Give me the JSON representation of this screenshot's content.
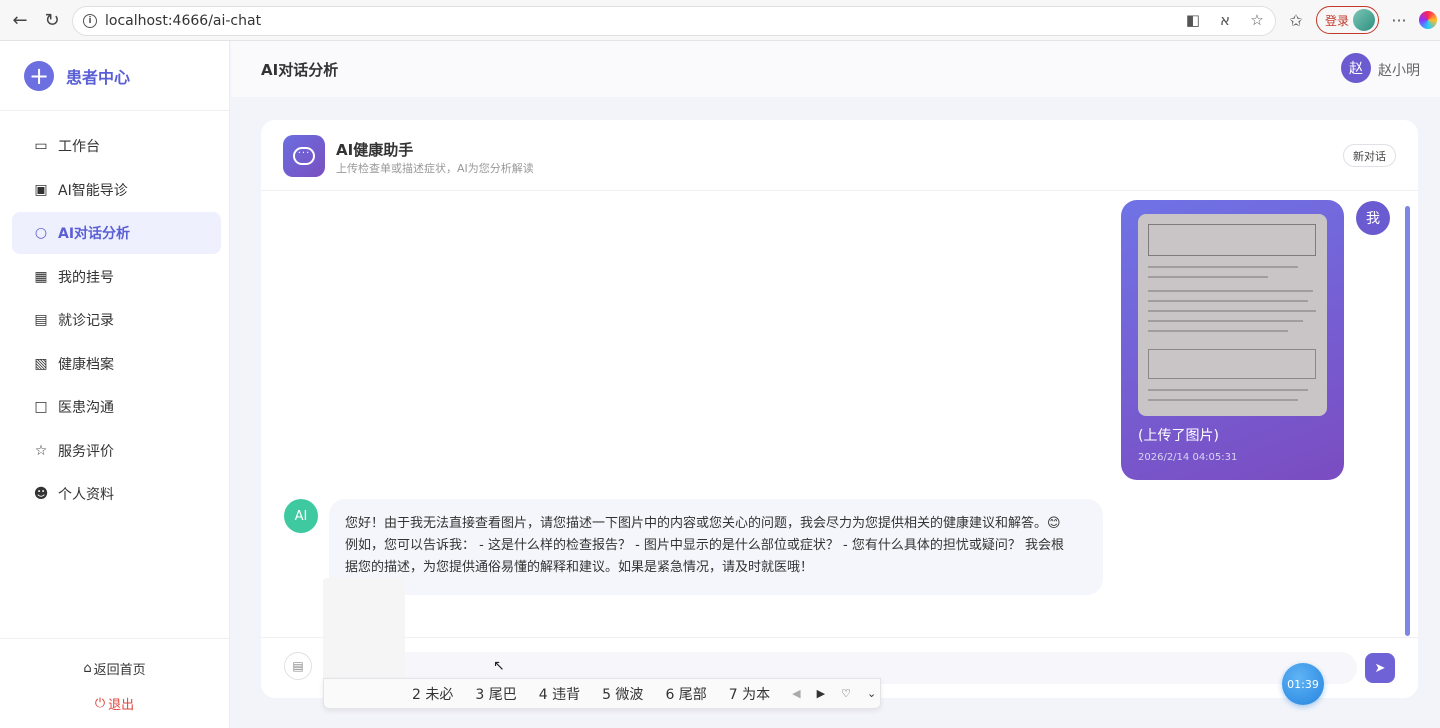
{
  "browser": {
    "url": "localhost:4666/ai-chat",
    "login_label": "登录"
  },
  "sidebar": {
    "brand": "患者中心",
    "items": [
      {
        "label": "工作台",
        "icon": "monitor-icon"
      },
      {
        "label": "AI智能导诊",
        "icon": "chip-icon"
      },
      {
        "label": "AI对话分析",
        "icon": "chat-dots-icon",
        "active": true
      },
      {
        "label": "我的挂号",
        "icon": "calendar-icon"
      },
      {
        "label": "就诊记录",
        "icon": "document-icon"
      },
      {
        "label": "健康档案",
        "icon": "chart-board-icon"
      },
      {
        "label": "医患沟通",
        "icon": "message-icon"
      },
      {
        "label": "服务评价",
        "icon": "star-icon"
      },
      {
        "label": "个人资料",
        "icon": "user-icon"
      }
    ],
    "back_home": "返回首页",
    "logout": "退出"
  },
  "header": {
    "title": "AI对话分析",
    "avatar_char": "赵",
    "user_name": "赵小明"
  },
  "chat": {
    "assistant_name": "AI健康助手",
    "assistant_subtitle": "上传检查单或描述症状，AI为您分析解读",
    "new_chat": "新对话",
    "user_message": {
      "avatar": "我",
      "caption": "(上传了图片)",
      "time": "2026/2/14 04:05:31"
    },
    "ai_message": {
      "avatar": "AI",
      "lines": [
        "您好！由于我无法直接查看图片，请您描述一下图片中的内容或您关心的问题，我会尽力为您提供相关的健康建议和解答。😊",
        "例如，您可以告诉我： - 这是什么样的检查报告？ - 图片中显示的是什么部位或症状？ - 您有什么具体的担忧或疑问？ 我会根",
        "据您的描述，为您提供通俗易懂的解释和建议。如果是紧急情况，请及时就医哦！"
      ]
    },
    "input_placeholder": ""
  },
  "ime": {
    "candidates": [
      "2 未必",
      "3 尾巴",
      "4 违背",
      "5 微波",
      "6 尾部",
      "7 为本"
    ]
  },
  "timer": "01:39"
}
